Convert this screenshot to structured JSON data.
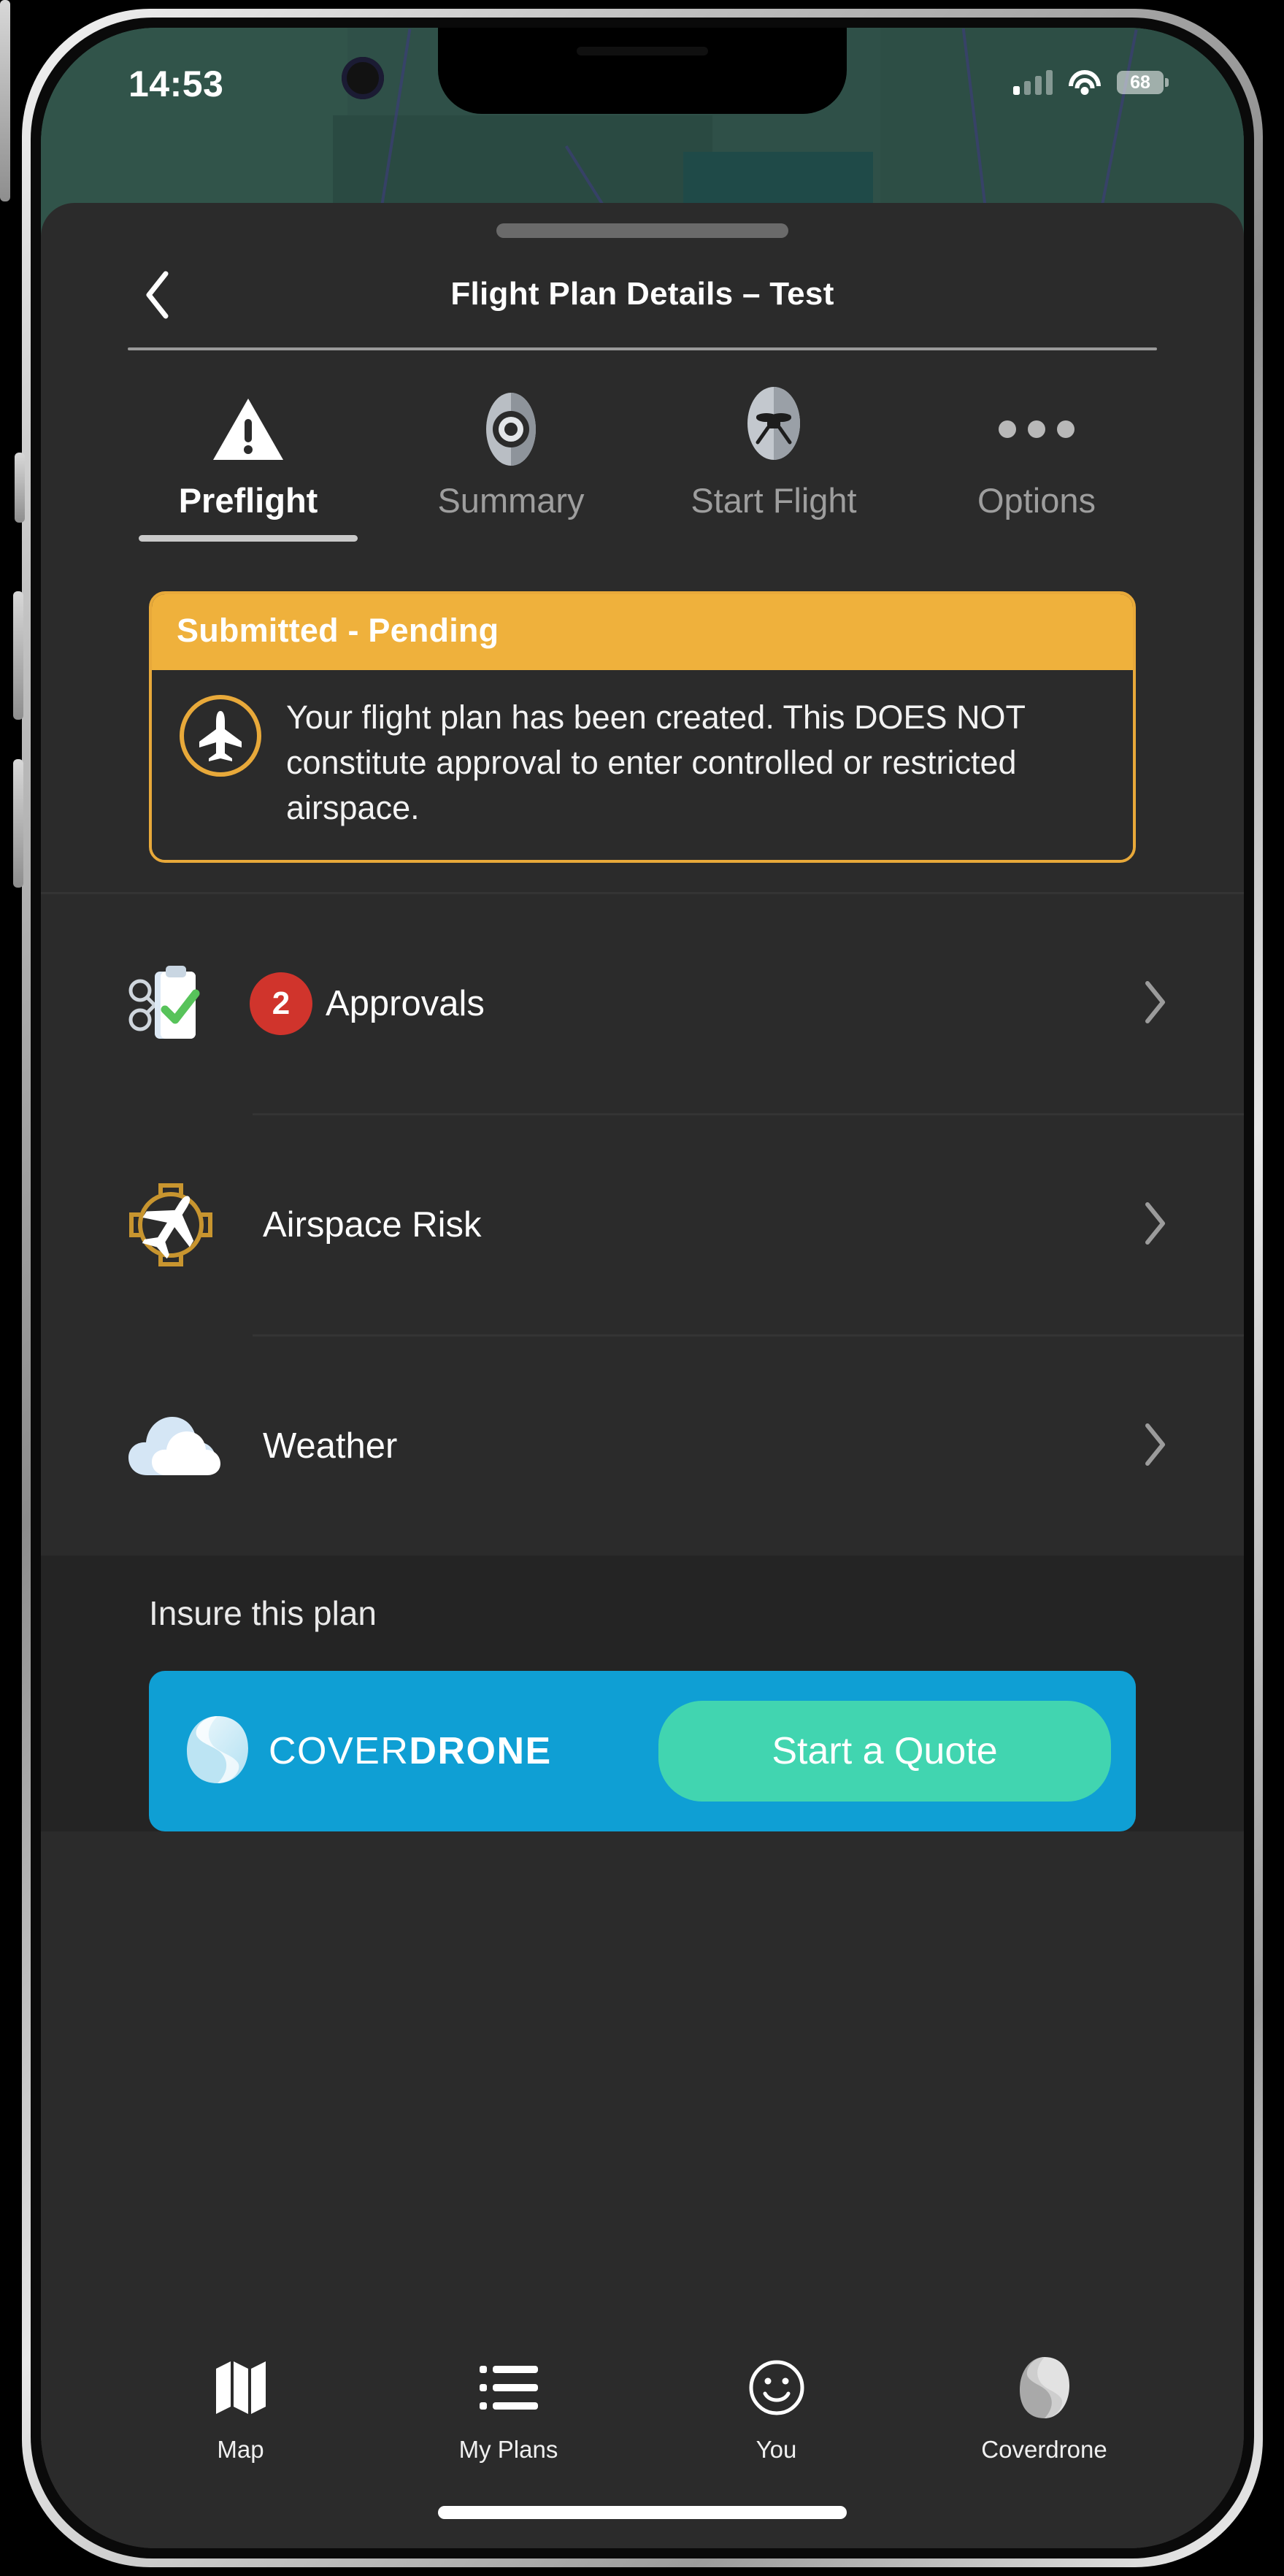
{
  "status_bar": {
    "time": "14:53",
    "battery_level": "68",
    "cellular_icon": "cellular-signal-icon",
    "wifi_icon": "wifi-icon",
    "battery_icon": "battery-icon"
  },
  "header": {
    "back_icon": "chevron-left-icon",
    "title": "Flight Plan Details – Test"
  },
  "tabs": [
    {
      "label": "Preflight",
      "icon": "warning-triangle-icon",
      "active": true
    },
    {
      "label": "Summary",
      "icon": "eye-icon",
      "active": false
    },
    {
      "label": "Start Flight",
      "icon": "drone-circle-icon",
      "active": false
    },
    {
      "label": "Options",
      "icon": "ellipsis-icon",
      "active": false
    }
  ],
  "status_card": {
    "header_label": "Submitted - Pending",
    "icon": "airplane-circle-icon",
    "body_text": "Your flight plan has been created. This DOES NOT constitute approval to enter controlled or restricted airspace.",
    "accent_color": "#efb13c",
    "border_color": "#e8a93a"
  },
  "rows": [
    {
      "label": "Approvals",
      "icon": "drone-clipboard-check-icon",
      "badge": "2",
      "badge_color": "#d0342c",
      "chevron": "chevron-right-icon"
    },
    {
      "label": "Airspace Risk",
      "icon": "airplane-restricted-icon",
      "badge": null,
      "chevron": "chevron-right-icon"
    },
    {
      "label": "Weather",
      "icon": "cloud-icon",
      "badge": null,
      "chevron": "chevron-right-icon"
    }
  ],
  "insure": {
    "heading": "Insure this plan",
    "brand_prefix": "COVER",
    "brand_suffix": "DRONE",
    "logo_icon": "coverdrone-swirl-icon",
    "cta_label": "Start a Quote",
    "banner_color": "#0f9fd4",
    "cta_color": "#41d5b0"
  },
  "bottom_nav": [
    {
      "label": "Map",
      "icon": "map-icon"
    },
    {
      "label": "My Plans",
      "icon": "list-icon"
    },
    {
      "label": "You",
      "icon": "smiley-face-icon"
    },
    {
      "label": "Coverdrone",
      "icon": "coverdrone-swirl-icon"
    }
  ]
}
